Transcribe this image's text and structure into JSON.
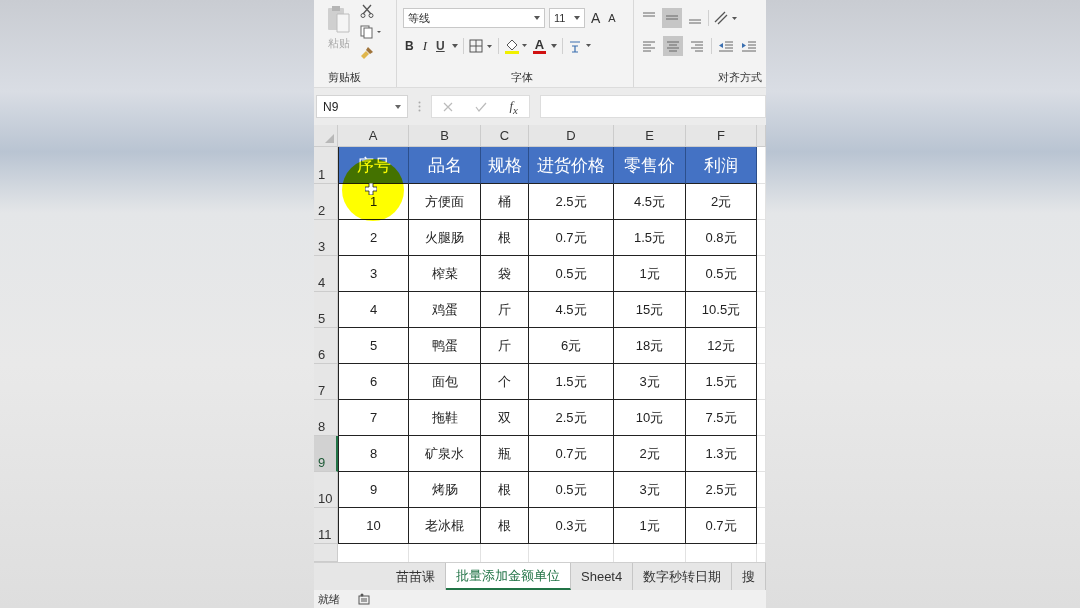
{
  "ribbon": {
    "clipboard": {
      "paste_label": "粘贴",
      "group_label": "剪贴板"
    },
    "font": {
      "font_name": "等线",
      "font_size": "11",
      "grow_label": "A",
      "shrink_label": "A",
      "bold_label": "B",
      "italic_label": "I",
      "underline_label": "U",
      "font_color_label": "A",
      "group_label": "字体"
    },
    "alignment": {
      "group_label": "对齐方式"
    }
  },
  "formula_bar": {
    "name_box": "N9",
    "function_label": "f$_{x}$"
  },
  "sheet": {
    "column_headers": [
      "A",
      "B",
      "C",
      "D",
      "E",
      "F"
    ],
    "row_headers": [
      {
        "label": "1",
        "selected": false
      },
      {
        "label": "2",
        "selected": false
      },
      {
        "label": "3",
        "selected": false
      },
      {
        "label": "4",
        "selected": false
      },
      {
        "label": "5",
        "selected": false
      },
      {
        "label": "6",
        "selected": false
      },
      {
        "label": "7",
        "selected": false
      },
      {
        "label": "8",
        "selected": false
      },
      {
        "label": "9",
        "selected": true
      },
      {
        "label": "10",
        "selected": false
      },
      {
        "label": "11",
        "selected": false
      }
    ],
    "table_header": [
      "序号",
      "品名",
      "规格",
      "进货价格",
      "零售价",
      "利润"
    ],
    "rows": [
      [
        "1",
        "方便面",
        "桶",
        "2.5元",
        "4.5元",
        "2元"
      ],
      [
        "2",
        "火腿肠",
        "根",
        "0.7元",
        "1.5元",
        "0.8元"
      ],
      [
        "3",
        "榨菜",
        "袋",
        "0.5元",
        "1元",
        "0.5元"
      ],
      [
        "4",
        "鸡蛋",
        "斤",
        "4.5元",
        "15元",
        "10.5元"
      ],
      [
        "5",
        "鸭蛋",
        "斤",
        "6元",
        "18元",
        "12元"
      ],
      [
        "6",
        "面包",
        "个",
        "1.5元",
        "3元",
        "1.5元"
      ],
      [
        "7",
        "拖鞋",
        "双",
        "2.5元",
        "10元",
        "7.5元"
      ],
      [
        "8",
        "矿泉水",
        "瓶",
        "0.7元",
        "2元",
        "1.3元"
      ],
      [
        "9",
        "烤肠",
        "根",
        "0.5元",
        "3元",
        "2.5元"
      ],
      [
        "10",
        "老冰棍",
        "根",
        "0.3元",
        "1元",
        "0.7元"
      ]
    ]
  },
  "sheet_tabs": [
    {
      "label": "苗苗课",
      "selected": false
    },
    {
      "label": "批量添加金额单位",
      "selected": true
    },
    {
      "label": "Sheet4",
      "selected": false
    },
    {
      "label": "数字秒转日期",
      "selected": false
    },
    {
      "label": "搜",
      "selected": false
    }
  ],
  "status_bar": {
    "text": "就绪"
  }
}
